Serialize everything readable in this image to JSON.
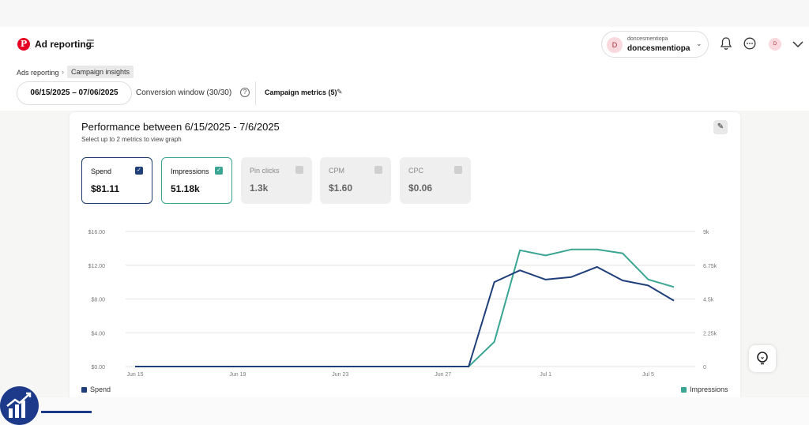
{
  "header": {
    "app_title": "Ad reporting",
    "account_small": "doncesmentiopa",
    "account_name": "doncesmentiopa",
    "account_initial": "D",
    "mini_avatar_initial": "D"
  },
  "breadcrumb": {
    "parent": "Ads reporting",
    "current": "Campaign insights"
  },
  "toolbar": {
    "date_range": "06/15/2025 – 07/06/2025",
    "conversion_window": "Conversion window (30/30)",
    "campaign_metrics": "Campaign metrics (5)"
  },
  "performance": {
    "title": "Performance between 6/15/2025 - 7/6/2025",
    "subtitle": "Select up to 2 metrics to view graph"
  },
  "metrics": [
    {
      "label": "Spend",
      "value": "$81.11",
      "selected": true
    },
    {
      "label": "Impressions",
      "value": "51.18k",
      "selected": true
    },
    {
      "label": "Pin clicks",
      "value": "1.3k",
      "selected": false
    },
    {
      "label": "CPM",
      "value": "$1.60",
      "selected": false
    },
    {
      "label": "CPC",
      "value": "$0.06",
      "selected": false
    }
  ],
  "chart_data": {
    "type": "line",
    "x": [
      "Jun 15",
      "Jun 16",
      "Jun 17",
      "Jun 18",
      "Jun 19",
      "Jun 20",
      "Jun 21",
      "Jun 22",
      "Jun 23",
      "Jun 24",
      "Jun 25",
      "Jun 26",
      "Jun 27",
      "Jun 28",
      "Jun 29",
      "Jun 30",
      "Jul 1",
      "Jul 2",
      "Jul 3",
      "Jul 4",
      "Jul 5",
      "Jul 6"
    ],
    "x_tick_labels": [
      "Jun 15",
      "Jun 19",
      "Jun 23",
      "Jun 27",
      "Jul 1",
      "Jul 5"
    ],
    "y_left_ticks": [
      "$0.00",
      "$4.00",
      "$8.00",
      "$12.00",
      "$16.00"
    ],
    "y_right_ticks": [
      "0",
      "2.25k",
      "4.5k",
      "6.75k",
      "9k"
    ],
    "ylim_left": [
      0,
      16
    ],
    "ylim_right": [
      0,
      9000
    ],
    "grid": true,
    "series": [
      {
        "name": "Spend",
        "axis": "left",
        "color": "#1f3f7a",
        "values": [
          0,
          0,
          0,
          0,
          0,
          0,
          0,
          0,
          0,
          0,
          0,
          0,
          0,
          0,
          10.0,
          11.4,
          10.3,
          10.6,
          11.8,
          10.2,
          9.6,
          7.8
        ]
      },
      {
        "name": "Impressions",
        "axis": "right",
        "color": "#3aa592",
        "values": [
          0,
          0,
          0,
          0,
          0,
          0,
          0,
          0,
          0,
          0,
          0,
          0,
          0,
          0,
          1650,
          7750,
          7400,
          7800,
          7800,
          7550,
          5800,
          5300
        ]
      }
    ]
  }
}
